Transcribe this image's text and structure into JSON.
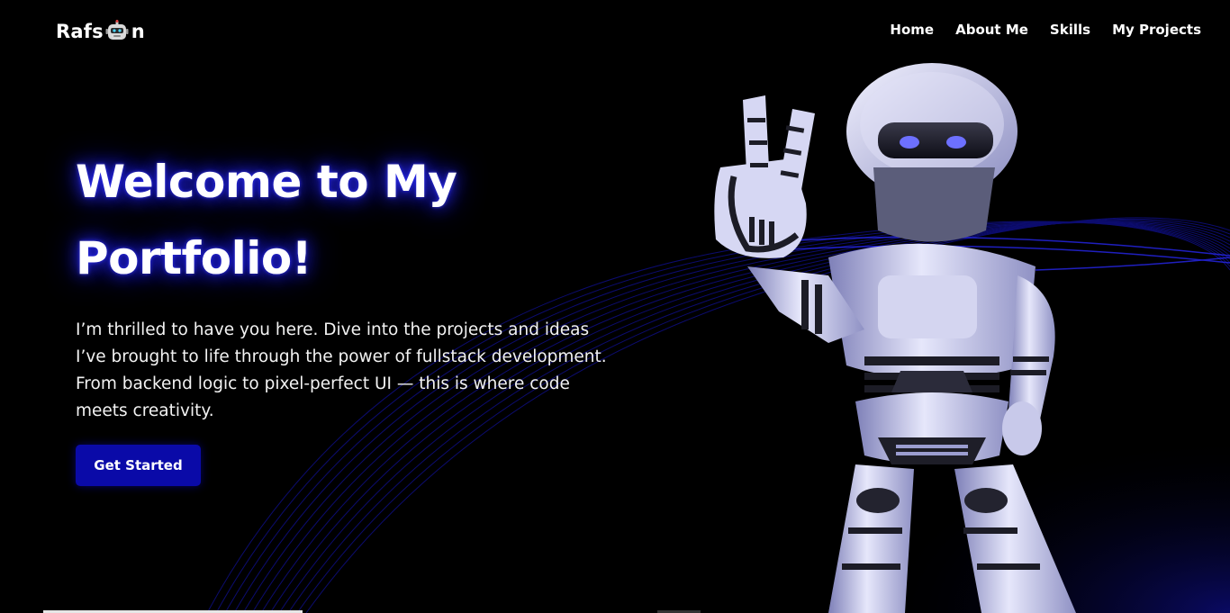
{
  "brand": {
    "prefix": "Rafs",
    "suffix": "n",
    "icon": "robot-head-icon"
  },
  "nav": {
    "items": [
      {
        "label": "Home"
      },
      {
        "label": "About Me"
      },
      {
        "label": "Skills"
      },
      {
        "label": "My Projects"
      }
    ]
  },
  "hero": {
    "title_line1": "Welcome to My",
    "title_line2": "Portfolio!",
    "description": "I’m thrilled to have you here. Dive into the projects and ideas I’ve brought to life through the power of fullstack development. From backend logic to pixel-perfect UI — this is where code meets creativity.",
    "cta_label": "Get Started"
  },
  "colors": {
    "background": "#000000",
    "accent": "#0a0aa8",
    "glow": "#2828ff",
    "text": "#ffffff"
  }
}
